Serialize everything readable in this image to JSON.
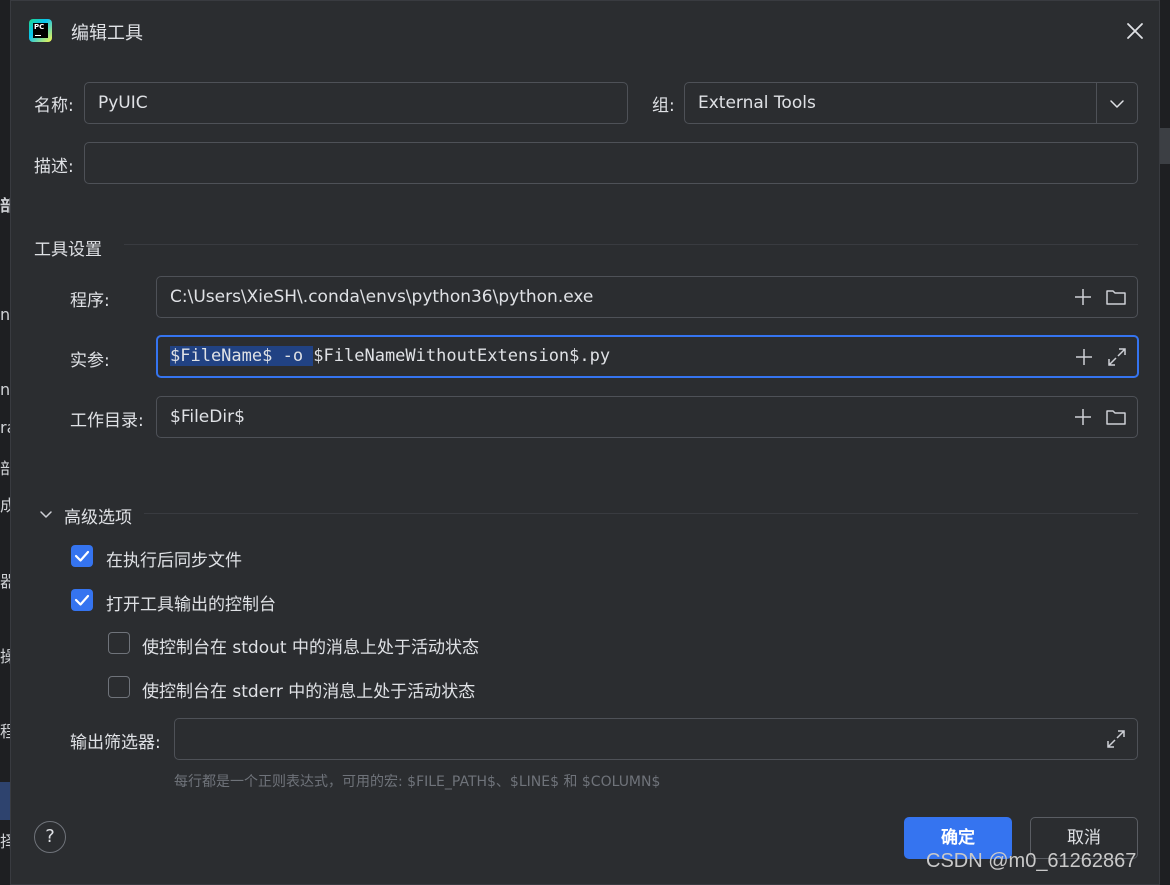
{
  "dialog": {
    "title": "编辑工具",
    "app_icon_text": "PC"
  },
  "form": {
    "name_label": "名称:",
    "name_value": "PyUIC",
    "group_label": "组:",
    "group_value": "External Tools",
    "description_label": "描述:",
    "description_value": ""
  },
  "tool_settings": {
    "section_title": "工具设置",
    "program_label": "程序:",
    "program_value": "C:\\Users\\XieSH\\.conda\\envs\\python36\\python.exe",
    "args_label": "实参:",
    "args_selected": "$FileName$ -o ",
    "args_rest": "$FileNameWithoutExtension$.py",
    "workdir_label": "工作目录:",
    "workdir_value": "$FileDir$"
  },
  "advanced": {
    "section_title": "高级选项",
    "checkboxes": [
      {
        "label": "在执行后同步文件",
        "checked": true
      },
      {
        "label": "打开工具输出的控制台",
        "checked": true
      },
      {
        "label": "使控制台在 stdout 中的消息上处于活动状态",
        "checked": false
      },
      {
        "label": "使控制台在 stderr 中的消息上处于活动状态",
        "checked": false
      }
    ],
    "output_filter_label": "输出筛选器:",
    "output_filter_value": "",
    "hint": "每行都是一个正则表达式，可用的宏: $FILE_PATH$、$LINE$ 和 $COLUMN$"
  },
  "footer": {
    "help_symbol": "?",
    "ok_label": "确定",
    "cancel_label": "取消"
  },
  "watermark": "CSDN @m0_61262867",
  "background_fragments": [
    "部",
    "nt",
    "n",
    "ra",
    "部",
    "成",
    "器",
    "操作",
    "程序",
    "择"
  ],
  "colors": {
    "dialog_bg": "#2b2d30",
    "accent": "#3574f0",
    "border": "#4e5157",
    "text": "#dfe1e5",
    "hint_text": "#6f737a"
  }
}
